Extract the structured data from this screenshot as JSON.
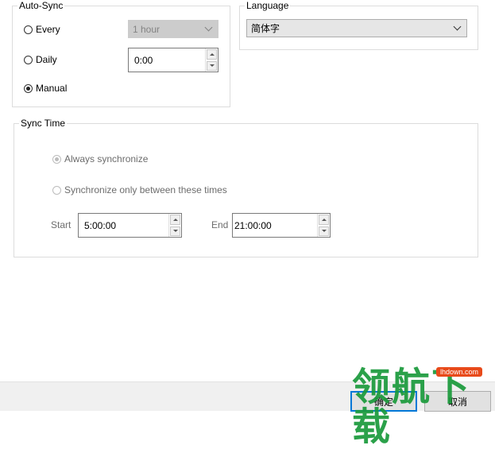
{
  "auto_sync": {
    "legend": "Auto-Sync",
    "every_label": "Every",
    "daily_label": "Daily",
    "manual_label": "Manual",
    "every_value": "1 hour",
    "daily_value": "0:00",
    "selected": "Manual"
  },
  "language": {
    "legend": "Language",
    "selected": "简体字"
  },
  "sync_time": {
    "legend": "Sync Time",
    "always_label": "Always synchronize",
    "between_label": "Synchronize only between these times",
    "start_label": "Start",
    "start_value": "5:00:00",
    "end_label": "End",
    "end_value": "21:00:00"
  },
  "footer": {
    "ok_label": "确定",
    "cancel_label": "取消"
  },
  "watermark": {
    "text": "领航下载",
    "url": "lhdown.com"
  }
}
